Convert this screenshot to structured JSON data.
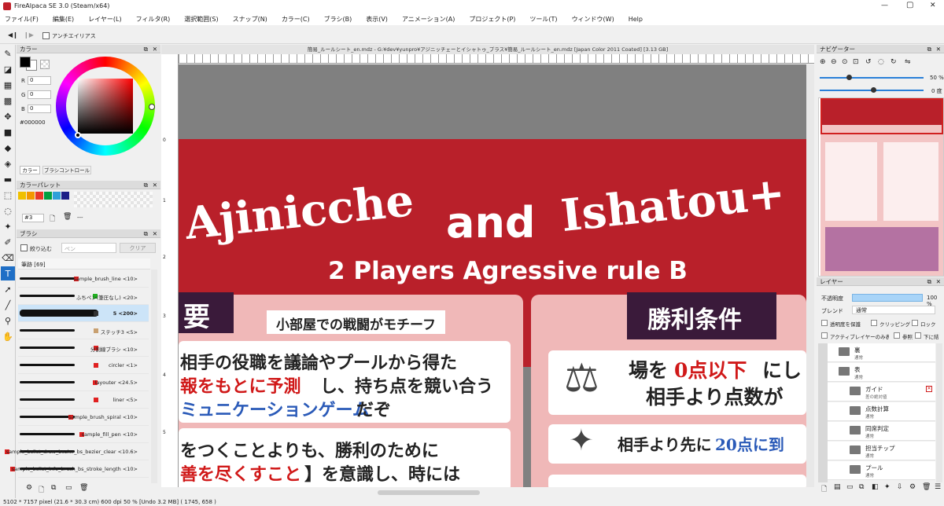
{
  "app": {
    "title": "FireAlpaca SE 3.0 (Steam/x64)",
    "window_controls": [
      "—",
      "▢",
      "✕"
    ]
  },
  "menu": [
    "ファイル(F)",
    "編集(E)",
    "レイヤー(L)",
    "フィルタ(R)",
    "選択範囲(S)",
    "スナップ(N)",
    "カラー(C)",
    "ブラシ(B)",
    "表示(V)",
    "アニメーション(A)",
    "プロジェクト(P)",
    "ツール(T)",
    "ウィンドウ(W)",
    "Help"
  ],
  "toolbar": {
    "antialias": "アンチエイリアス"
  },
  "document": {
    "title": "簡易_ルールシート_en.mdz - G:¥dev¥yunpro¥アジニッチェーとイシャトゥ_プラス¥簡易_ルールシート_en.mdz [Japan Color 2011 Coated] [3.13 GB]"
  },
  "color_panel": {
    "title": "カラー",
    "r_label": "R",
    "g_label": "G",
    "b_label": "B",
    "r": "0",
    "g": "0",
    "b": "0",
    "hex": "#000000",
    "tabs": [
      "カラー",
      "ブラシコントロール"
    ]
  },
  "palette": {
    "title": "カラーパレット",
    "colors": [
      "#f0c000",
      "#f39800",
      "#e83828",
      "#00a040",
      "#2ea0d8",
      "#1d2088"
    ],
    "selector": "#3",
    "extra": "---"
  },
  "brush_panel": {
    "title": "ブラシ",
    "narrow": "絞り込む",
    "placeholder": "ペン",
    "clear": "クリア",
    "group": "筆跡 [69]",
    "items": [
      {
        "name": "sample_brush_line <10>",
        "color": "#e02020"
      },
      {
        "name": "ふちペン(筆圧なし) <20>",
        "color": "#20b020"
      },
      {
        "name": "5 <200>",
        "color": "#333333"
      },
      {
        "name": "ステッチ3 <5>",
        "color": "#c8a070"
      },
      {
        "name": "分割線ブラシ <10>",
        "color": "#e02020"
      },
      {
        "name": "circler <1>",
        "color": "#e02020"
      },
      {
        "name": "layouter <24.5>",
        "color": "#e02020"
      },
      {
        "name": "liner <5>",
        "color": "#e02020"
      },
      {
        "name": "sample_brush_spiral <10>",
        "color": "#e02020"
      },
      {
        "name": "sample_fill_pen <10>",
        "color": "#e02020"
      },
      {
        "name": "sample_bslist_draw_bezier_bs_bezier_clear <10.6>",
        "color": "#e02020"
      },
      {
        "name": "sample_bslist_info_brush_bs_stroke_length <10>",
        "color": "#e02020"
      }
    ]
  },
  "canvas": {
    "title_part1": "Ajinicche",
    "title_and": "and",
    "title_part2": "Ishatou+",
    "subtitle": "2 Players Agressive rule B",
    "left_head": "要",
    "left_sub": "小部屋での戦闘がモチーフ",
    "left_p1_l1": "相手の役職を議論やプールから得た",
    "left_p1_l2a": "報をもとに予測",
    "left_p1_l2b": "し、持ち点を競い合う",
    "left_p1_l3a": "ミュニケーションゲーム",
    "left_p1_l3b": "だぞ",
    "left_p2_l1": "をつくことよりも、勝利のために",
    "left_p2_l2a": "善を尽くすこと",
    "left_p2_l2b": "】を意識し、時には",
    "right_head": "勝利条件",
    "right_b1_l1a": "場を",
    "right_b1_l1b": "0点以下",
    "right_b1_l1c": "にし",
    "right_b1_l2": "相手より点数が",
    "right_b2_a": "相手より先に",
    "right_b2_b": "20点に到",
    "ruler": [
      "0",
      "1",
      "2",
      "3",
      "4",
      "5"
    ]
  },
  "navigator": {
    "title": "ナビゲーター",
    "zoom": "50 %",
    "angle": "0 度"
  },
  "layers": {
    "title": "レイヤー",
    "opacity_label": "不透明度",
    "opacity": "100 %",
    "blend_label": "ブレンド",
    "blend": "通常",
    "protect": "透明度を保護",
    "clipping": "クリッピング",
    "lock": "ロック",
    "active_only": "アクティブレイヤーのみ表示",
    "ref": "参照",
    "down": "下に結",
    "items": [
      {
        "name": "裏",
        "sub": "通常",
        "indent": 0
      },
      {
        "name": "表",
        "sub": "通常",
        "indent": 0
      },
      {
        "name": "ガイド",
        "sub": "差の絶対値",
        "indent": 1
      },
      {
        "name": "点数計算",
        "sub": "通常",
        "indent": 1
      },
      {
        "name": "同席判定",
        "sub": "通常",
        "indent": 1
      },
      {
        "name": "担当チップ",
        "sub": "通常",
        "indent": 1
      },
      {
        "name": "プール",
        "sub": "通常",
        "indent": 1
      }
    ]
  },
  "status": "5102 * 7157 pixel  (21.6 * 30.3 cm)  600 dpi  50 %  [Undo 3.2 MB]  ( 1745, 658 )"
}
